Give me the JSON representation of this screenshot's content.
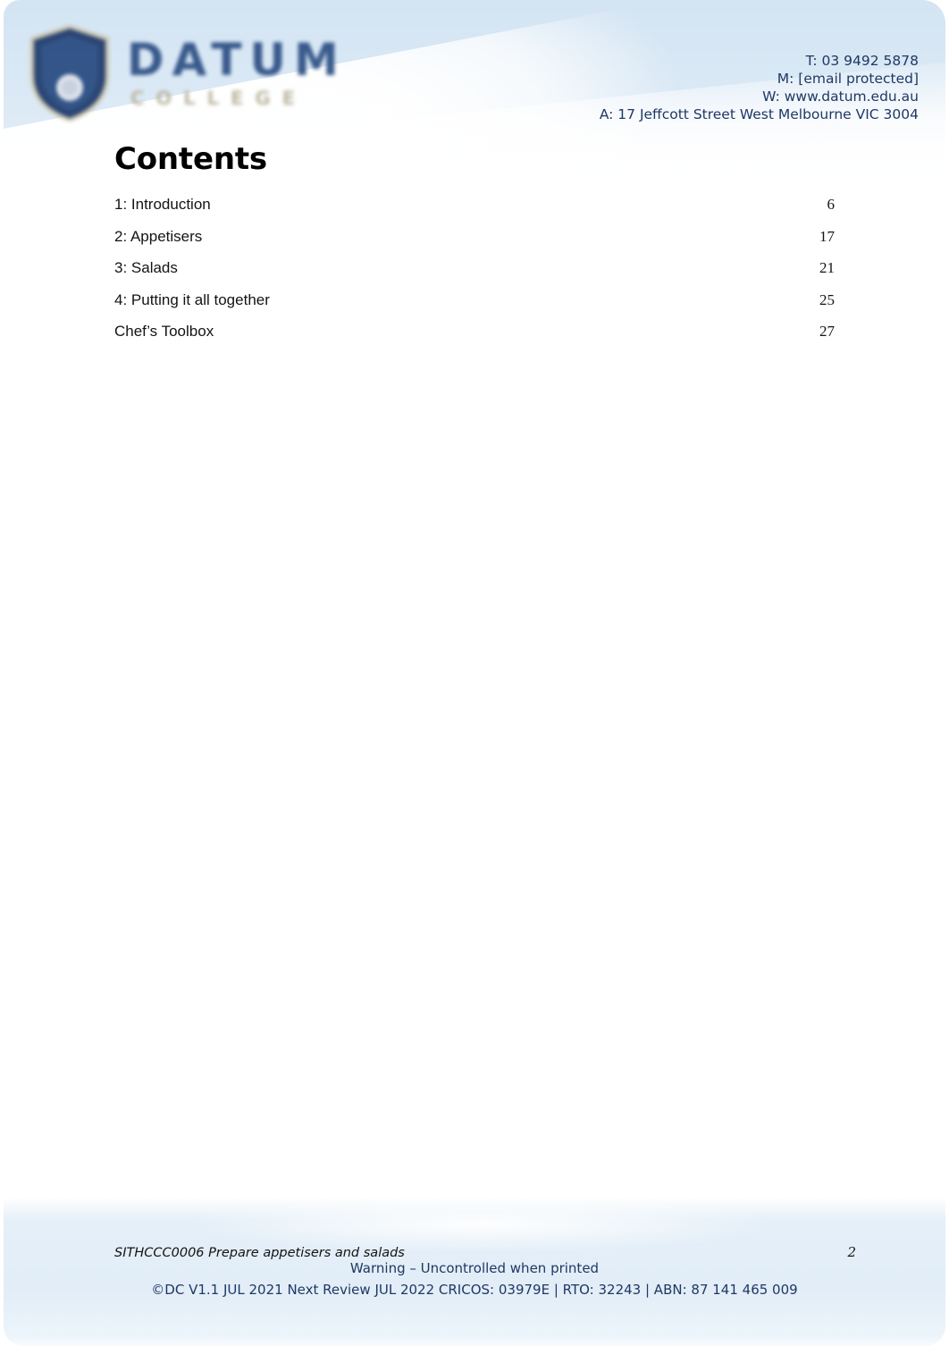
{
  "header": {
    "logo": {
      "wordmark": "DATUM",
      "subtitle": "COLLEGE",
      "shield_icon": "shield-icon"
    },
    "contact": {
      "phone": "T: 03 9492 5878",
      "email": "M: [email protected]",
      "website": "W: www.datum.edu.au",
      "address": "A: 17 Jeffcott Street West Melbourne VIC 3004"
    }
  },
  "main": {
    "title": "Contents",
    "toc": [
      {
        "label": "1: Introduction",
        "page": "6"
      },
      {
        "label": "2: Appetisers",
        "page": "17"
      },
      {
        "label": "3: Salads",
        "page": "21"
      },
      {
        "label": "4: Putting it all together",
        "page": "25"
      },
      {
        "label": "Chef’s Toolbox",
        "page": "27"
      }
    ]
  },
  "footer": {
    "document_id": "SITHCCC0006 Prepare appetisers and salads",
    "page_number": "2",
    "warning": "Warning – Uncontrolled when printed",
    "legal": "©DC V1.1 JUL 2021 Next Review JUL 2022 CRICOS: 03979E | RTO: 32243 | ABN: 87 141 465 009"
  },
  "colors": {
    "header_band": "#d6e6f4",
    "footer_band": "#e2edf7",
    "brand_navy": "#1f3864",
    "logo_blue": "#2d4f84",
    "logo_gold": "#b9b29a",
    "page_background": "#ffffff",
    "body_text": "#141414"
  }
}
